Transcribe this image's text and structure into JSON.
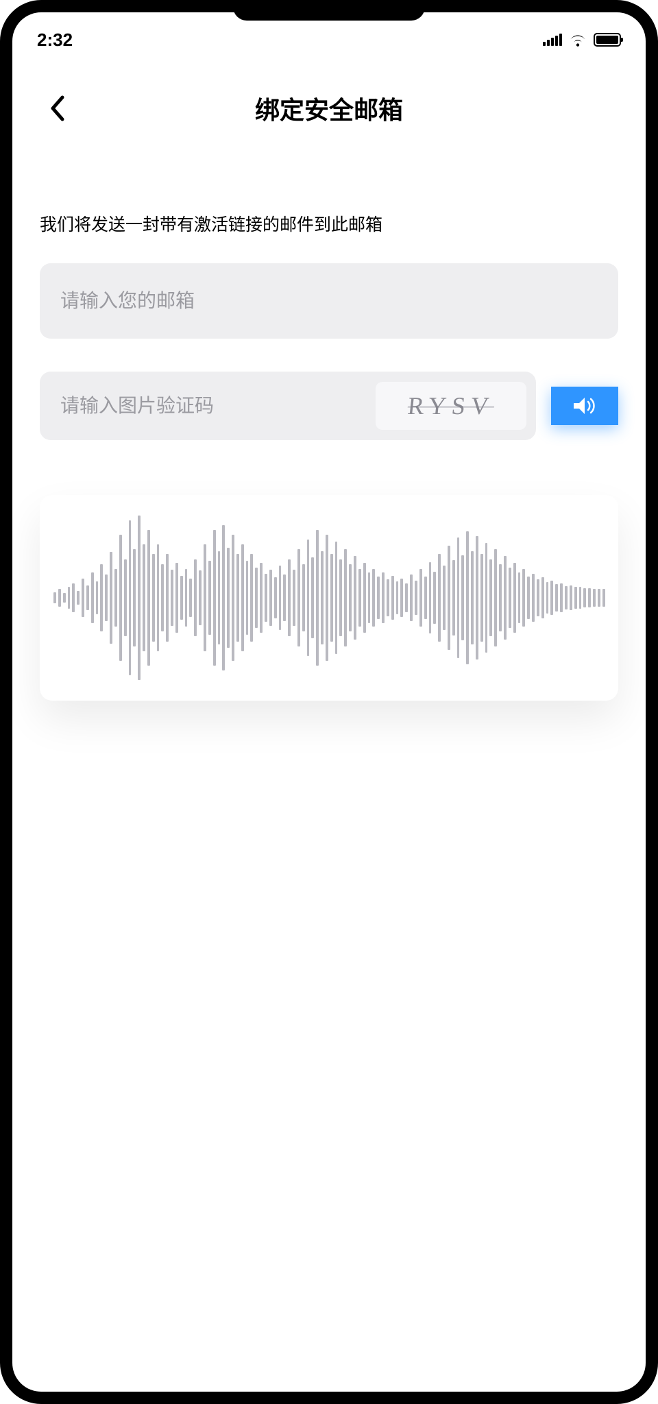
{
  "status": {
    "time": "2:32"
  },
  "header": {
    "title": "绑定安全邮箱"
  },
  "instruction": "我们将发送一封带有激活链接的邮件到此邮箱",
  "email": {
    "placeholder": "请输入您的邮箱",
    "value": ""
  },
  "captcha": {
    "placeholder": "请输入图片验证码",
    "value": "",
    "imageText": "RYSV"
  },
  "waveform": {
    "heights": [
      12,
      18,
      10,
      22,
      30,
      14,
      40,
      26,
      52,
      34,
      70,
      48,
      95,
      60,
      130,
      80,
      160,
      100,
      170,
      110,
      140,
      90,
      110,
      70,
      90,
      58,
      72,
      46,
      60,
      40,
      80,
      56,
      110,
      76,
      140,
      96,
      150,
      104,
      130,
      90,
      110,
      76,
      90,
      62,
      72,
      50,
      58,
      42,
      66,
      48,
      80,
      58,
      100,
      70,
      120,
      84,
      140,
      96,
      130,
      90,
      116,
      80,
      100,
      70,
      86,
      60,
      72,
      52,
      60,
      44,
      52,
      38,
      46,
      34,
      40,
      30,
      48,
      36,
      60,
      44,
      74,
      54,
      90,
      66,
      108,
      78,
      124,
      88,
      138,
      96,
      128,
      90,
      114,
      80,
      100,
      70,
      86,
      62,
      72,
      52,
      60,
      44,
      50,
      38,
      42,
      32,
      36,
      28,
      30,
      24,
      26,
      22,
      22,
      20,
      20,
      18,
      18,
      18
    ]
  }
}
